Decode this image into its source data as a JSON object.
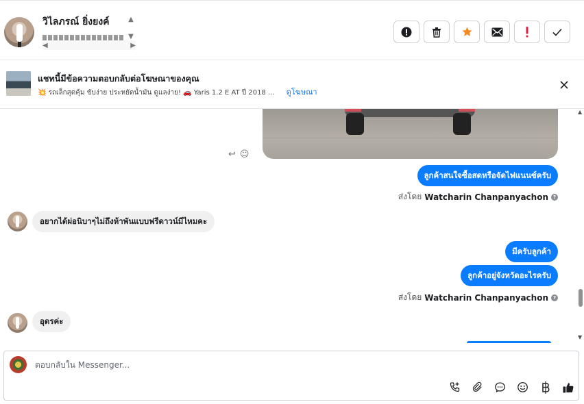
{
  "header": {
    "contact_name": "วิไลภรณ์ ยิ่งยงค์",
    "toolbar": [
      {
        "name": "spam-button",
        "icon": "exclamation-circle-icon"
      },
      {
        "name": "delete-button",
        "icon": "trash-icon"
      },
      {
        "name": "star-button",
        "icon": "star-icon"
      },
      {
        "name": "mark-unread-button",
        "icon": "envelope-icon"
      },
      {
        "name": "follow-up-button",
        "icon": "exclamation-icon"
      },
      {
        "name": "mark-done-button",
        "icon": "check-icon"
      }
    ]
  },
  "ad": {
    "title": "แชทนี้มีข้อความตอบกลับต่อโฆษณาของคุณ",
    "desc_1": "💥 รถเล็กสุดคุ้ม ขับง่าย ประหยัดน้ำมัน ดูแลง่าย!",
    "desc_2": "🚗 Yaris 1.2 E AT ปี 2018 ...",
    "link": "ดูโฆษณา"
  },
  "messages": {
    "out_1": "ลูกค้าสนใจซื้อสดหรือจัดไฟแนนซ์ครับ",
    "sent_by_prefix": "ส่งโดย",
    "sender": "Watcharin Chanpanyachon",
    "in_1": "อยากได้ผ่อนิบาๆไม่ถึงห้าพันแบบฟรีดาวน์มีไหมคะ",
    "out_2": "มีครับลูกค้า",
    "out_3": "ลูกค้าอยู่จังหวัดอะไรครับ",
    "in_2": "อุดรค่ะ"
  },
  "composer": {
    "placeholder": "ตอบกลับใน Messenger..."
  },
  "colors": {
    "accent": "#0a7cff",
    "star": "#f5891f",
    "flag": "#e41e3f"
  }
}
